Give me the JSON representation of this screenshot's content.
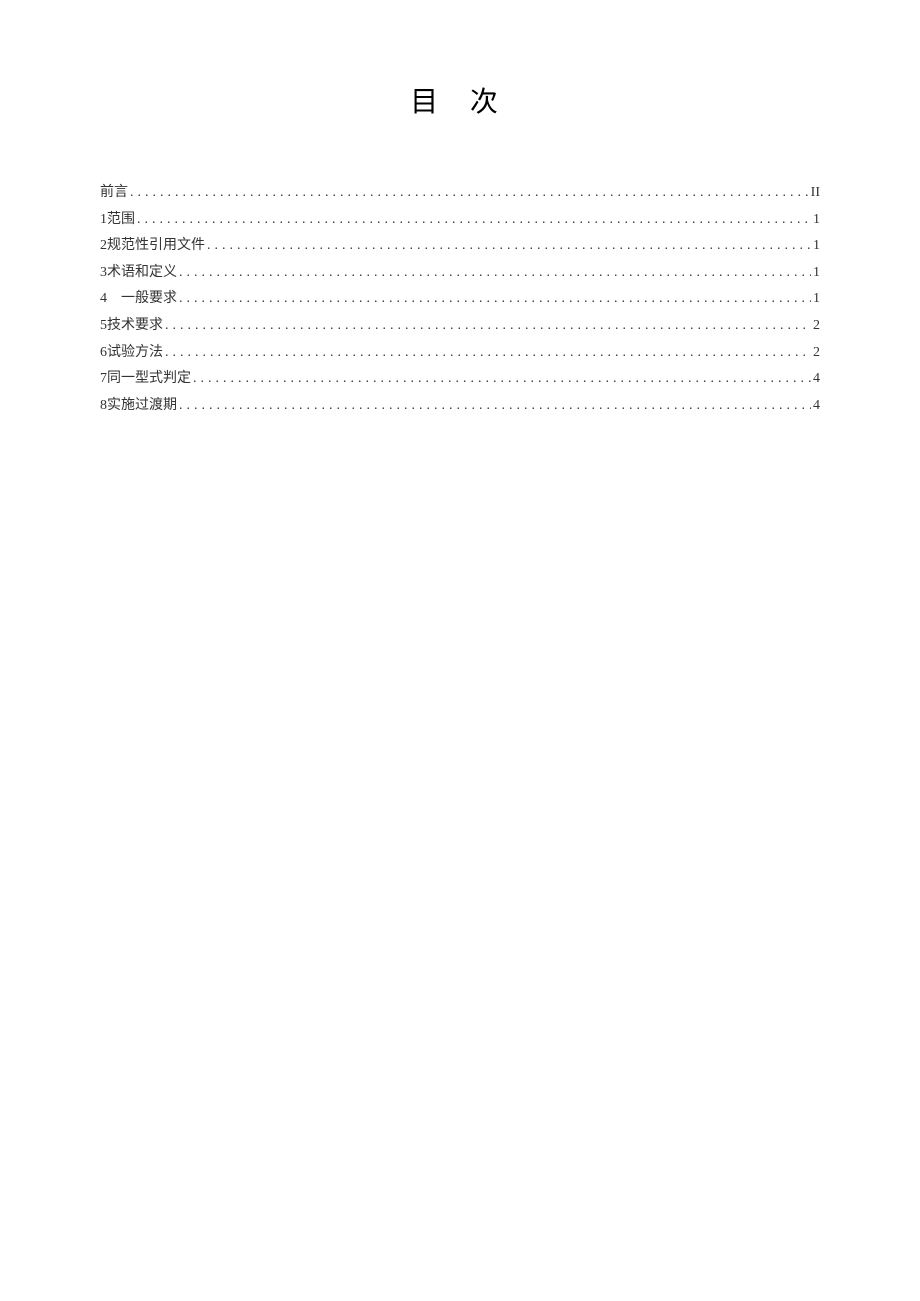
{
  "title": "目 次",
  "toc": [
    {
      "label": "前言",
      "page": "II"
    },
    {
      "label": "1范围",
      "page": "1"
    },
    {
      "label": "2规范性引用文件",
      "page": "1"
    },
    {
      "label": "3术语和定义",
      "page": "1"
    },
    {
      "label": "4 一般要求",
      "page": "1"
    },
    {
      "label": "5技术要求",
      "page": "2"
    },
    {
      "label": "6试验方法",
      "page": "2"
    },
    {
      "label": "7同一型式判定",
      "page": "4"
    },
    {
      "label": "8实施过渡期",
      "page": "4"
    }
  ]
}
